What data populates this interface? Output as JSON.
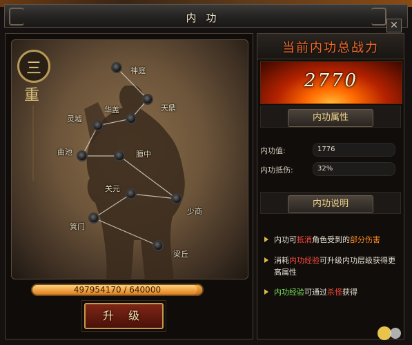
{
  "window": {
    "title": "内功"
  },
  "level": {
    "char_top": "三",
    "char_bottom": "重"
  },
  "acupoints": [
    {
      "id": "shenting",
      "label": "神庭"
    },
    {
      "id": "tianding",
      "label": "天鼎"
    },
    {
      "id": "huagai",
      "label": "华盖"
    },
    {
      "id": "lingxu",
      "label": "灵墟"
    },
    {
      "id": "quchi",
      "label": "曲池"
    },
    {
      "id": "danzhong",
      "label": "膻中"
    },
    {
      "id": "shaoshang",
      "label": "少商"
    },
    {
      "id": "guanyuan",
      "label": "关元"
    },
    {
      "id": "jimen",
      "label": "箕门"
    },
    {
      "id": "liangqiu",
      "label": "梁丘"
    }
  ],
  "progress": {
    "text": "497954170 / 640000",
    "current": 497954170,
    "max": 640000,
    "fill_fraction": 0.97
  },
  "buttons": {
    "upgrade": "升 级"
  },
  "power": {
    "title": "当前内功总战力",
    "value": "2770"
  },
  "attributes": {
    "header": "内功属性",
    "rows": [
      {
        "label": "内功值:",
        "value": "1776"
      },
      {
        "label": "内功抵伤:",
        "value": "32%"
      }
    ]
  },
  "description": {
    "header": "内功说明",
    "items": [
      {
        "p1": "内功可",
        "h1": "抵消",
        "p2": "角色受到的",
        "h2": "部分伤害",
        "p3": ""
      },
      {
        "p1": "消耗",
        "h1": "内功经验",
        "p2": "可升级内功层级获得更高属性",
        "h2": "",
        "p3": ""
      },
      {
        "p1": "",
        "h1": "内功经验",
        "p2": "可通过",
        "h2": "杀怪",
        "p3": "获得"
      }
    ]
  },
  "colors": {
    "accent_red": "#ff4b3c",
    "accent_orange": "#ff8a1c",
    "accent_green": "#7be35a",
    "gold": "#efd48a"
  },
  "icons": {
    "close": "close-icon",
    "bullet": "bullet-arrow-icon"
  }
}
